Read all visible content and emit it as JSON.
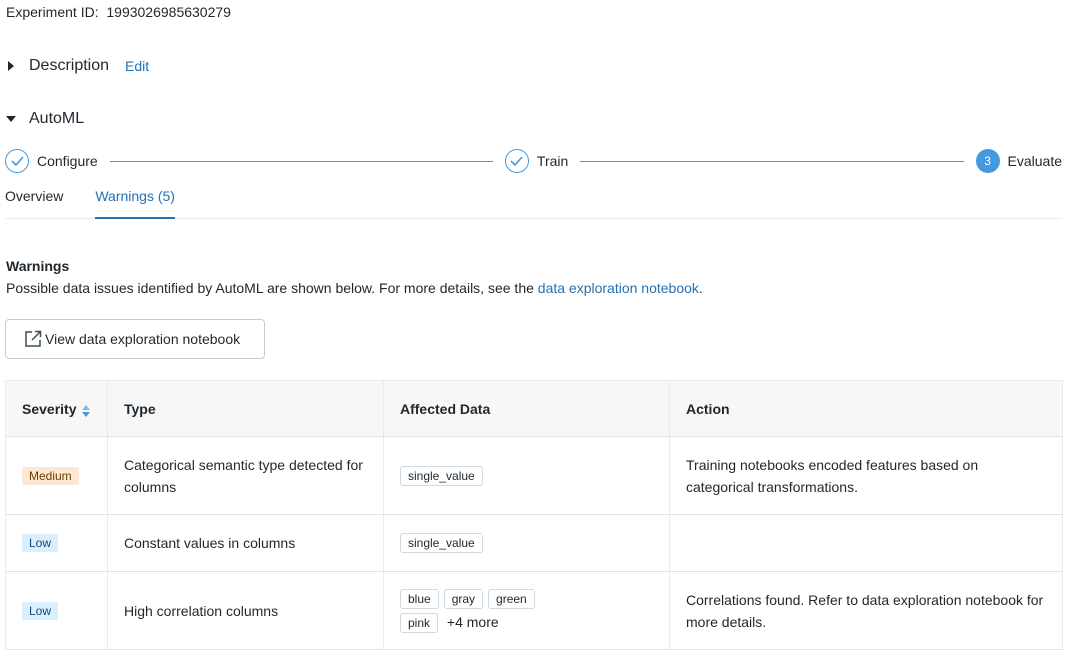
{
  "experiment": {
    "label": "Experiment ID:",
    "value": "1993026985630279"
  },
  "description": {
    "title": "Description",
    "edit_label": "Edit"
  },
  "automl": {
    "title": "AutoML"
  },
  "stepper": {
    "steps": [
      {
        "label": "Configure",
        "state": "done"
      },
      {
        "label": "Train",
        "state": "done"
      },
      {
        "label": "Evaluate",
        "state": "active",
        "number": "3"
      }
    ],
    "accent_color": "#4299e0"
  },
  "tabs": [
    {
      "label": "Overview",
      "active": false
    },
    {
      "label": "Warnings (5)",
      "active": true
    }
  ],
  "warnings": {
    "title": "Warnings",
    "description_prefix": "Possible data issues identified by AutoML are shown below. For more details, see the ",
    "description_link": "data exploration notebook",
    "description_suffix": ".",
    "button_label": "View data exploration notebook",
    "button_icon": "external-link-icon"
  },
  "table": {
    "columns": [
      "Severity",
      "Type",
      "Affected Data",
      "Action"
    ],
    "rows": [
      {
        "severity": "Medium",
        "type": "Categorical semantic type detected for columns",
        "tags": [
          "single_value"
        ],
        "more": "",
        "action": "Training notebooks encoded features based on categorical transformations."
      },
      {
        "severity": "Low",
        "type": "Constant values in columns",
        "tags": [
          "single_value"
        ],
        "more": "",
        "action": ""
      },
      {
        "severity": "Low",
        "type": "High correlation columns",
        "tags": [
          "blue",
          "gray",
          "green",
          "pink"
        ],
        "more": "+4 more",
        "action": "Correlations found. Refer to data exploration notebook for more details."
      }
    ]
  },
  "colors": {
    "link": "#2272b4",
    "medium_badge_bg": "#fce8d3",
    "low_badge_bg": "#dbeefc"
  }
}
